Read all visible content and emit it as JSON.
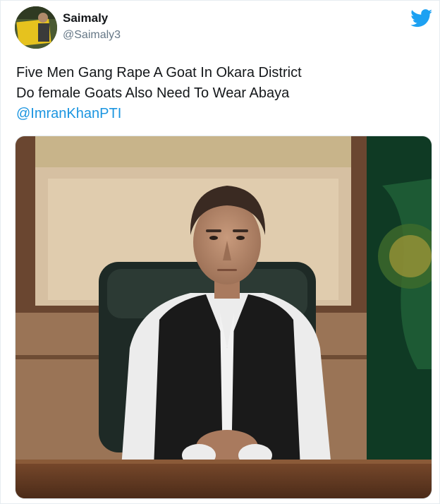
{
  "tweet": {
    "display_name": "Saimaly",
    "handle": "@Saimaly3",
    "lines": [
      "Five Men Gang Rape A Goat In Okara District",
      "Do female Goats Also Need To Wear Abaya"
    ],
    "mention": "@ImranKhanPTI"
  },
  "icons": {
    "platform": "twitter-bird-icon"
  },
  "colors": {
    "twitter_blue": "#1da1f2",
    "mention": "#1b95e0",
    "name": "#14171a",
    "handle": "#657786"
  }
}
